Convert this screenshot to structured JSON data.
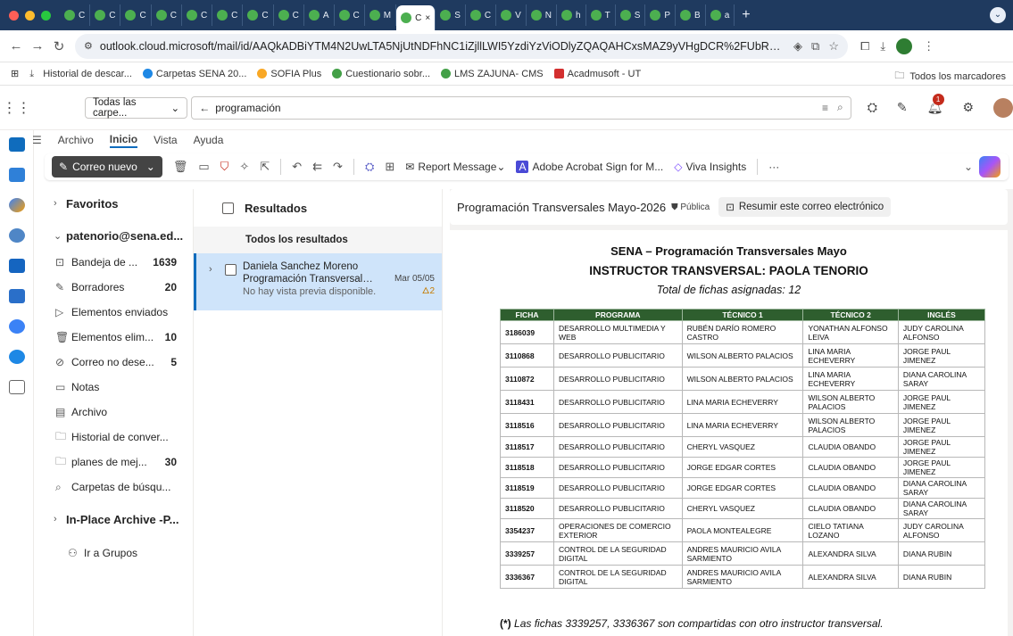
{
  "browser": {
    "tabs": [
      {
        "label": "C"
      },
      {
        "label": "C"
      },
      {
        "label": "C"
      },
      {
        "label": "C"
      },
      {
        "label": "C"
      },
      {
        "label": "C"
      },
      {
        "label": "C"
      },
      {
        "label": "C"
      },
      {
        "label": "A"
      },
      {
        "label": "C"
      },
      {
        "label": "M"
      },
      {
        "label": "C",
        "active": true
      },
      {
        "label": "S"
      },
      {
        "label": "C"
      },
      {
        "label": "V"
      },
      {
        "label": "N"
      },
      {
        "label": "h"
      },
      {
        "label": "T"
      },
      {
        "label": "S"
      },
      {
        "label": "P"
      },
      {
        "label": "B"
      },
      {
        "label": "a"
      }
    ],
    "url": "outlook.cloud.microsoft/mail/id/AAQkADBiYTM4N2UwLTA5NjUtNDFhNC1iZjllLWI5YzdiYzViODlyZQAQAHCxsMAZ9yVHgDCR%2FUbR2Zs%3D?culture...",
    "bookmarks": [
      "Historial de descar...",
      "Carpetas SENA 20...",
      "SOFIA Plus",
      "Cuestionario sobr...",
      "LMS ZAJUNA- CMS",
      "Acadmusoft - UT"
    ],
    "bookmarks_all": "Todos los marcadores"
  },
  "outlook": {
    "folder_dropdown": "Todas las carpe...",
    "search_query": "programación",
    "notification_count": "1",
    "ribbon_tabs": [
      "Archivo",
      "Inicio",
      "Vista",
      "Ayuda"
    ],
    "new_mail": "Correo nuevo",
    "report_message": "Report Message",
    "adobe": "Adobe Acrobat Sign for M...",
    "viva": "Viva Insights",
    "more": "···"
  },
  "folders": {
    "favoritos": "Favoritos",
    "account": "patenorio@sena.ed...",
    "items": [
      {
        "label": "Bandeja de ...",
        "count": "1639",
        "icon": "inbox-icon"
      },
      {
        "label": "Borradores",
        "count": "20",
        "icon": "drafts-icon"
      },
      {
        "label": "Elementos enviados",
        "count": "",
        "icon": "sent-icon"
      },
      {
        "label": "Elementos elim...",
        "count": "10",
        "icon": "trash-icon"
      },
      {
        "label": "Correo no dese...",
        "count": "5",
        "icon": "junk-icon"
      },
      {
        "label": "Notas",
        "count": "",
        "icon": "notes-icon"
      },
      {
        "label": "Archivo",
        "count": "",
        "icon": "archive-icon"
      },
      {
        "label": "Historial de conver...",
        "count": "",
        "icon": "folder-icon"
      },
      {
        "label": "planes de mej...",
        "count": "30",
        "icon": "folder-icon"
      },
      {
        "label": "Carpetas de búsqu...",
        "count": "",
        "icon": "search-folder-icon"
      }
    ],
    "archive": "In-Place Archive -P...",
    "groups": "Ir a Grupos"
  },
  "messages": {
    "header": "Resultados",
    "all_results": "Todos los resultados",
    "item": {
      "sender": "Daniela Sanchez Moreno",
      "subject": "Programación Transversales...",
      "date": "Mar 05/05",
      "preview": "No hay vista previa disponible.",
      "attachments": "2"
    }
  },
  "reading": {
    "subject": "Programación Transversales Mayo-2026",
    "visibility": "Pública",
    "summarize": "Resumir este correo electrónico",
    "title1": "SENA – Programación Transversales Mayo",
    "title2": "INSTRUCTOR TRANSVERSAL: PAOLA TENORIO",
    "subtitle": "Total de fichas asignadas: 12",
    "table": {
      "headers": [
        "FICHA",
        "PROGRAMA",
        "TÉCNICO 1",
        "TÉCNICO 2",
        "INGLÉS"
      ],
      "rows": [
        [
          "3186039",
          "DESARROLLO MULTIMEDIA Y WEB",
          "RUBÉN DARÍO ROMERO CASTRO",
          "YONATHAN ALFONSO LEIVA",
          "JUDY CAROLINA ALFONSO"
        ],
        [
          "3110868",
          "DESARROLLO PUBLICITARIO",
          "WILSON ALBERTO PALACIOS",
          "LINA MARIA ECHEVERRY",
          "JORGE PAUL JIMENEZ"
        ],
        [
          "3110872",
          "DESARROLLO PUBLICITARIO",
          "WILSON ALBERTO PALACIOS",
          "LINA MARIA ECHEVERRY",
          "DIANA CAROLINA SARAY"
        ],
        [
          "3118431",
          "DESARROLLO PUBLICITARIO",
          "LINA MARIA ECHEVERRY",
          "WILSON ALBERTO PALACIOS",
          "JORGE PAUL JIMENEZ"
        ],
        [
          "3118516",
          "DESARROLLO PUBLICITARIO",
          "LINA MARIA ECHEVERRY",
          "WILSON ALBERTO PALACIOS",
          "JORGE PAUL JIMENEZ"
        ],
        [
          "3118517",
          "DESARROLLO PUBLICITARIO",
          "CHERYL VASQUEZ",
          "CLAUDIA OBANDO",
          "JORGE PAUL JIMENEZ"
        ],
        [
          "3118518",
          "DESARROLLO PUBLICITARIO",
          "JORGE EDGAR CORTES",
          "CLAUDIA OBANDO",
          "JORGE PAUL JIMENEZ"
        ],
        [
          "3118519",
          "DESARROLLO PUBLICITARIO",
          "JORGE EDGAR CORTES",
          "CLAUDIA OBANDO",
          "DIANA CAROLINA SARAY"
        ],
        [
          "3118520",
          "DESARROLLO PUBLICITARIO",
          "CHERYL VASQUEZ",
          "CLAUDIA OBANDO",
          "DIANA CAROLINA SARAY"
        ],
        [
          "3354237",
          "OPERACIONES DE COMERCIO EXTERIOR",
          "PAOLA MONTEALEGRE",
          "CIELO TATIANA LOZANO",
          "JUDY CAROLINA ALFONSO"
        ],
        [
          "3339257",
          "CONTROL DE LA SEGURIDAD DIGITAL",
          "ANDRES MAURICIO AVILA SARMIENTO",
          "ALEXANDRA SILVA",
          "DIANA RUBIN"
        ],
        [
          "3336367",
          "CONTROL DE LA SEGURIDAD DIGITAL",
          "ANDRES MAURICIO AVILA SARMIENTO",
          "ALEXANDRA SILVA",
          "DIANA RUBIN"
        ]
      ],
      "tall_rows": [
        0,
        1,
        2,
        3,
        4,
        9,
        10,
        11
      ]
    },
    "note_mark": "(*)",
    "note": "Las fichas 3339257, 3336367 son compartidas con otro instructor transversal."
  },
  "colors": {
    "accent": "#0f6cbd",
    "table_header": "#2e5e2e",
    "selected": "#cfe4fa"
  }
}
